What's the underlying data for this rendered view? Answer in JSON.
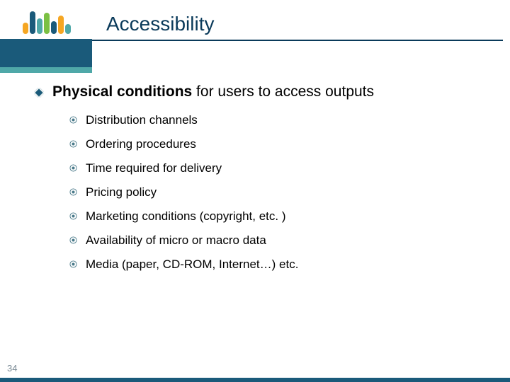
{
  "slide": {
    "title": "Accessibility",
    "page_number": "34",
    "logo_bars": [
      {
        "color": "#f5a623",
        "height": 16
      },
      {
        "color": "#1a5a7a",
        "height": 32
      },
      {
        "color": "#4fa8a8",
        "height": 22
      },
      {
        "color": "#7bc043",
        "height": 30
      },
      {
        "color": "#1a5a7a",
        "height": 18
      },
      {
        "color": "#f5a623",
        "height": 26
      },
      {
        "color": "#4fa8a8",
        "height": 14
      }
    ],
    "main_bullet_bold": "Physical conditions",
    "main_bullet_rest": " for users to access outputs",
    "sub_bullets": [
      "Distribution channels",
      "Ordering procedures",
      "Time required for delivery",
      "Pricing policy",
      "Marketing conditions (copyright, etc. )",
      "Availability of micro or macro data",
      "Media (paper, CD-ROM, Internet…) etc."
    ]
  }
}
